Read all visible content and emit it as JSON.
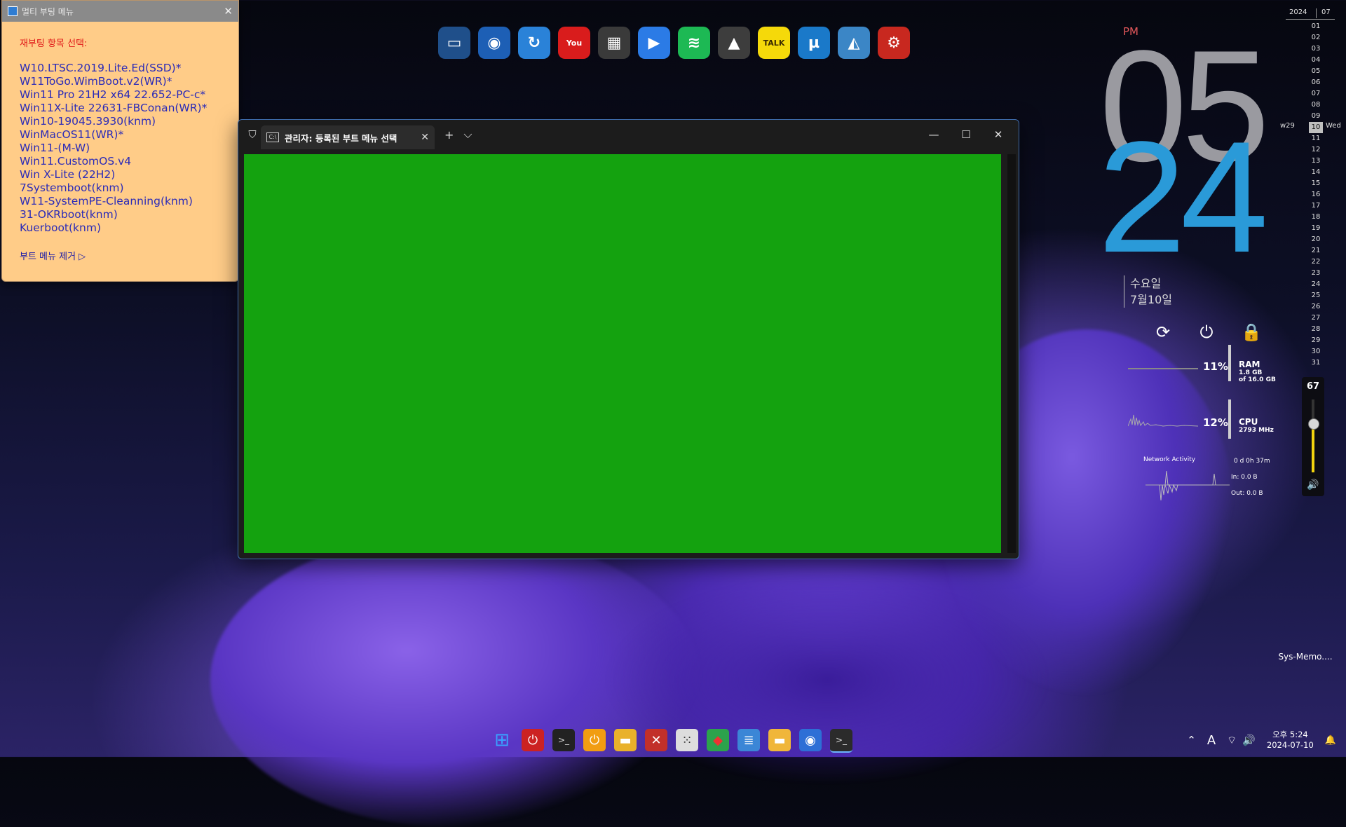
{
  "boot_window": {
    "title": "멀티 부팅 메뉴",
    "heading": "재부팅 항목 선택:",
    "items": [
      "W10.LTSC.2019.Lite.Ed(SSD)*",
      "W11ToGo.WimBoot.v2(WR)*",
      "Win11 Pro 21H2 x64 22.652-PC-c*",
      "Win11X-Lite 22631-FBConan(WR)*",
      "Win10-19045.3930(knm)",
      "WinMacOS11(WR)*",
      "Win11-(M-W)",
      "Win11.CustomOS.v4",
      "Win X-Lite (22H2)",
      "7Systemboot(knm)",
      "W11-SystemPE-Cleanning(knm)",
      "31-OKRboot(knm)",
      "Kuerboot(knm)"
    ],
    "remove_label": "부트 메뉴 제거 ▷",
    "close": "✕"
  },
  "dock_apps": [
    {
      "name": "monitor-icon",
      "glyph": "▭",
      "bg": "#1f4f8a"
    },
    {
      "name": "globe-icon",
      "glyph": "◉",
      "bg": "#1d5fb5"
    },
    {
      "name": "sync-app-icon",
      "glyph": "↻",
      "bg": "#2a82d8"
    },
    {
      "name": "youtube-icon",
      "glyph": "You",
      "bg": "#d91c1c"
    },
    {
      "name": "store-icon",
      "glyph": "▦",
      "bg": "#3a3a3a"
    },
    {
      "name": "play-icon",
      "glyph": "▶",
      "bg": "#2b7be6"
    },
    {
      "name": "spotify-icon",
      "glyph": "≋",
      "bg": "#1db954"
    },
    {
      "name": "triangle-app-icon",
      "glyph": "▲",
      "bg": "#3d3d3d"
    },
    {
      "name": "kakaotalk-icon",
      "glyph": "TALK",
      "bg": "#f5d90a"
    },
    {
      "name": "utorrent-icon",
      "glyph": "µ",
      "bg": "#1a79c9"
    },
    {
      "name": "photos-icon",
      "glyph": "◭",
      "bg": "#3b86c6"
    },
    {
      "name": "settings-gear-icon",
      "glyph": "⚙",
      "bg": "#c8281f"
    }
  ],
  "terminal": {
    "tab_title": "관리자: 등록된 부트 메뉴 선택",
    "tab_close": "✕",
    "new_tab": "+",
    "dropdown": "⌵",
    "minimize": "—",
    "maximize": "☐",
    "close": "✕",
    "shield": "⛉"
  },
  "clock": {
    "ampm": "PM",
    "hour": "05",
    "minute": "24",
    "weekday": "수요일",
    "date": "7월10일"
  },
  "system_controls": {
    "refresh": "⟳",
    "power": "⏻",
    "lock": "🔒"
  },
  "stats": {
    "ram_pct": "11%",
    "ram_label": "RAM",
    "ram_used": "1.8 GB",
    "ram_total": "of 16.0 GB",
    "cpu_pct": "12%",
    "cpu_label": "CPU",
    "cpu_freq": "2793 MHz",
    "net_label": "Network Activity",
    "uptime": "0 d 0h 37m",
    "net_in": "In: 0.0 B",
    "net_out": "Out: 0.0 B"
  },
  "calendar": {
    "year": "2024",
    "month": "07",
    "week": "w29",
    "weekday": "Wed",
    "today": "10",
    "days": [
      "01",
      "02",
      "03",
      "04",
      "05",
      "06",
      "07",
      "08",
      "09",
      "10",
      "11",
      "12",
      "13",
      "14",
      "15",
      "16",
      "17",
      "18",
      "19",
      "20",
      "21",
      "22",
      "23",
      "24",
      "25",
      "26",
      "27",
      "28",
      "29",
      "30",
      "31"
    ]
  },
  "volume": {
    "level": "67",
    "level_fraction": 0.67,
    "speaker": "🔊"
  },
  "desktop_icon": {
    "label": "Sys-Memo...."
  },
  "taskbar": {
    "icons": [
      {
        "name": "start-icon",
        "glyph": "⊞",
        "bg": "transparent",
        "color": "#3aa0ff"
      },
      {
        "name": "power-app-icon",
        "glyph": "⏻",
        "bg": "#c22",
        "color": "#fff"
      },
      {
        "name": "cmd-icon",
        "glyph": ">_",
        "bg": "#222",
        "color": "#ddd"
      },
      {
        "name": "shutdown-app-icon",
        "glyph": "⏻",
        "bg": "#f19d12",
        "color": "#fff"
      },
      {
        "name": "file-explorer-icon",
        "glyph": "▬",
        "bg": "#e9b12b",
        "color": "#fff"
      },
      {
        "name": "dx-app-icon",
        "glyph": "✕",
        "bg": "#c2302a",
        "color": "#fff"
      },
      {
        "name": "grid-app-icon",
        "glyph": "⁙",
        "bg": "#ddd",
        "color": "#333"
      },
      {
        "name": "colorful-app-icon",
        "glyph": "◆",
        "bg": "#2ca34c",
        "color": "#e33"
      },
      {
        "name": "notepad-icon",
        "glyph": "≣",
        "bg": "#3b86d6",
        "color": "#fff"
      },
      {
        "name": "folder-icon",
        "glyph": "▬",
        "bg": "#f0b63a",
        "color": "#fff"
      },
      {
        "name": "browser-icon",
        "glyph": "◉",
        "bg": "#2d6fd6",
        "color": "#fff"
      },
      {
        "name": "terminal-icon",
        "glyph": ">_",
        "bg": "#2b2b2b",
        "color": "#ddd"
      }
    ],
    "tray_chevron": "⌃",
    "ime": "A",
    "wifi": "⌔",
    "speaker": "🔊",
    "time": "오후 5:24",
    "date": "2024-07-10",
    "notify": "🔔"
  }
}
